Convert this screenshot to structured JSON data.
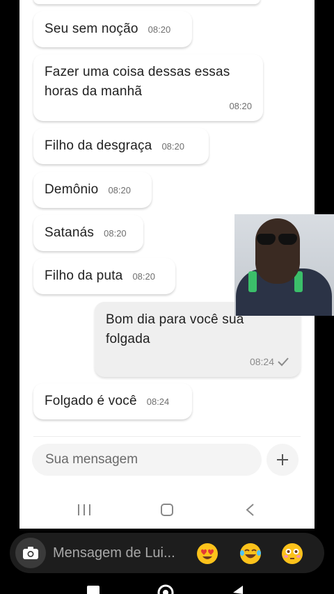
{
  "chat": {
    "messages": [
      {
        "text": "Seu sem noção",
        "time": "08:20"
      },
      {
        "text": "Fazer uma coisa dessas essas\nhoras da manhã",
        "time": "08:20"
      },
      {
        "text": "Filho da desgraça",
        "time": "08:20"
      },
      {
        "text": "Demônio",
        "time": "08:20"
      },
      {
        "text": "Satanás",
        "time": "08:20"
      },
      {
        "text": "Filho da puta",
        "time": "08:20"
      },
      {
        "text": "Bom dia para você sua\nfolgada",
        "time": "08:24",
        "read_icon": "check-icon"
      },
      {
        "text": "Folgado é você",
        "time": "08:24"
      }
    ],
    "composer": {
      "placeholder": "Sua mensagem"
    }
  },
  "overlay": {
    "description_icon": "video-overlay-person"
  },
  "instagram": {
    "placeholder": "Mensagem de Lui...",
    "reactions": [
      "😍",
      "😂",
      "😳"
    ]
  },
  "colors": {
    "incoming_bubble": "#ffffff",
    "outgoing_bubble": "#efefef",
    "page_bg": "#000000",
    "ig_bar": "#1d1d1d"
  }
}
